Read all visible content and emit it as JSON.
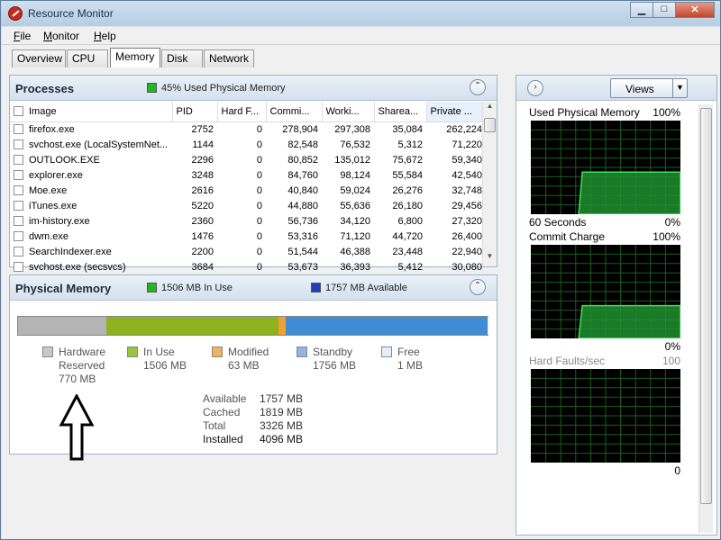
{
  "window": {
    "title": "Resource Monitor",
    "minimize_glyph": "▁",
    "maximize_glyph": "□",
    "close_glyph": "✕"
  },
  "menu": [
    "File",
    "Monitor",
    "Help"
  ],
  "tabs": [
    {
      "label": "Overview",
      "active": false
    },
    {
      "label": "CPU",
      "active": false
    },
    {
      "label": "Memory",
      "active": true
    },
    {
      "label": "Disk",
      "active": false
    },
    {
      "label": "Network",
      "active": false
    }
  ],
  "processes": {
    "title": "Processes",
    "status": "45% Used Physical Memory",
    "status_color": "#22b822",
    "collapse_glyph": "⌃",
    "columns": [
      "Image",
      "PID",
      "Hard F...",
      "Commi...",
      "Worki...",
      "Sharea...",
      "Private ..."
    ],
    "rows": [
      [
        "firefox.exe",
        "2752",
        "0",
        "278,904",
        "297,308",
        "35,084",
        "262,224"
      ],
      [
        "svchost.exe (LocalSystemNet...",
        "1144",
        "0",
        "82,548",
        "76,532",
        "5,312",
        "71,220"
      ],
      [
        "OUTLOOK.EXE",
        "2296",
        "0",
        "80,852",
        "135,012",
        "75,672",
        "59,340"
      ],
      [
        "explorer.exe",
        "3248",
        "0",
        "84,760",
        "98,124",
        "55,584",
        "42,540"
      ],
      [
        "Moe.exe",
        "2616",
        "0",
        "40,840",
        "59,024",
        "26,276",
        "32,748"
      ],
      [
        "iTunes.exe",
        "5220",
        "0",
        "44,880",
        "55,636",
        "26,180",
        "29,456"
      ],
      [
        "im-history.exe",
        "2360",
        "0",
        "56,736",
        "34,120",
        "6,800",
        "27,320"
      ],
      [
        "dwm.exe",
        "1476",
        "0",
        "53,316",
        "71,120",
        "44,720",
        "26,400"
      ],
      [
        "SearchIndexer.exe",
        "2200",
        "0",
        "51,544",
        "46,388",
        "23,448",
        "22,940"
      ],
      [
        "svchost.exe (secsvcs)",
        "3684",
        "0",
        "53,673",
        "36,393",
        "5,412",
        "30,080"
      ]
    ],
    "scroll_up": "▲",
    "scroll_down": "▼"
  },
  "physical_memory": {
    "title": "Physical Memory",
    "in_use_label": "1506 MB In Use",
    "available_label": "1757 MB Available",
    "in_use_color": "#22b822",
    "available_color": "#1f3fb8",
    "collapse_glyph": "⌃",
    "bar": [
      {
        "name": "Hardware Reserved",
        "mb": 770,
        "color": "#b4b4b4"
      },
      {
        "name": "In Use",
        "mb": 1506,
        "color": "#8db31e"
      },
      {
        "name": "Modified",
        "mb": 63,
        "color": "#f0a030"
      },
      {
        "name": "Standby",
        "mb": 1756,
        "color": "#3f8bd4"
      },
      {
        "name": "Free",
        "mb": 1,
        "color": "#e8eef6"
      }
    ],
    "legend": [
      {
        "line1": "Hardware",
        "line2": "Reserved",
        "value": "770 MB",
        "color": "#c8c8c8"
      },
      {
        "line1": "In Use",
        "line2": "",
        "value": "1506 MB",
        "color": "#9cc43a"
      },
      {
        "line1": "Modified",
        "line2": "",
        "value": "63 MB",
        "color": "#f2b35a"
      },
      {
        "line1": "Standby",
        "line2": "",
        "value": "1756 MB",
        "color": "#8fb5e0"
      },
      {
        "line1": "Free",
        "line2": "",
        "value": "1 MB",
        "color": "#e6edf6"
      }
    ],
    "summary": [
      {
        "key": "Available",
        "value": "1757 MB"
      },
      {
        "key": "Cached",
        "value": "1819 MB"
      },
      {
        "key": "Total",
        "value": "3326 MB"
      },
      {
        "key": "Installed",
        "value": "4096 MB"
      }
    ]
  },
  "graphs": {
    "expand_glyph": "›",
    "views_label": "Views",
    "views_dropdown_glyph": "▼",
    "items": [
      {
        "title": "Used Physical Memory",
        "max": "100%",
        "foot_left": "60 Seconds",
        "foot_right": "0%",
        "level": 0.45,
        "start_fraction": 0.32,
        "color": "#1f8f2e"
      },
      {
        "title": "Commit Charge",
        "max": "100%",
        "foot_left": "",
        "foot_right": "0%",
        "level": 0.35,
        "start_fraction": 0.32,
        "color": "#1f8f2e"
      },
      {
        "title": "Hard Faults/sec",
        "max": "100",
        "foot_left": "",
        "foot_right": "0",
        "level": 0,
        "start_fraction": 0.32,
        "color": "#1f8f2e"
      }
    ]
  }
}
